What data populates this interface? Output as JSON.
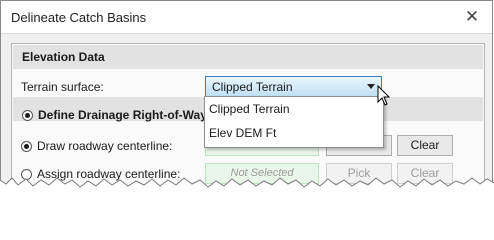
{
  "window": {
    "title": "Delineate Catch Basins"
  },
  "elevation_section": {
    "header": "Elevation Data",
    "terrain_label": "Terrain surface:",
    "terrain_selected": "Clipped Terrain",
    "dropdown_options": [
      "Clipped Terrain",
      "Elev DEM Ft"
    ]
  },
  "drainage_section": {
    "header": "Define Drainage Right-of-Way Us",
    "draw_label": "Draw roadway centerline:",
    "assign_label": "Assign roadway centerline:",
    "assign_field_value": "Not Selected",
    "pick_label": "Pick",
    "clear_label": "Clear"
  }
}
